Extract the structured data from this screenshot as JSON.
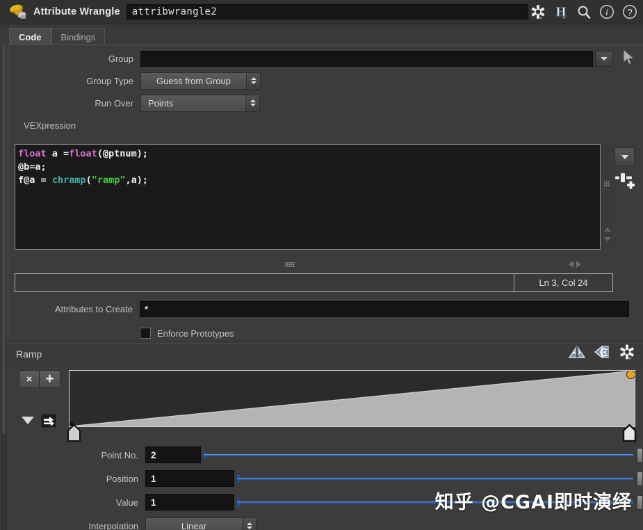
{
  "titlebar": {
    "node_type": "Attribute Wrangle",
    "node_name": "attribwrangle2",
    "icons": [
      {
        "name": "gear-icon",
        "label": "gear"
      },
      {
        "name": "houdini-h-icon",
        "label": "H"
      },
      {
        "name": "search-icon",
        "label": "search"
      },
      {
        "name": "info-icon",
        "label": "i"
      },
      {
        "name": "help-icon",
        "label": "?"
      }
    ]
  },
  "tabs": [
    {
      "label": "Code",
      "active": true
    },
    {
      "label": "Bindings",
      "active": false
    }
  ],
  "params": {
    "group": {
      "label": "Group",
      "value": "",
      "placeholder": ""
    },
    "group_type": {
      "label": "Group Type",
      "value": "Guess from Group"
    },
    "run_over": {
      "label": "Run Over",
      "value": "Points"
    },
    "vexpression": {
      "label": "VEXpression"
    },
    "attributes_to_create": {
      "label": "Attributes to Create",
      "value": "*"
    },
    "enforce_prototypes": {
      "label": "Enforce Prototypes",
      "checked": false
    }
  },
  "code": {
    "lines": [
      [
        {
          "t": "float",
          "c": "type"
        },
        {
          "t": " a =",
          "c": "txt"
        },
        {
          "t": "float",
          "c": "type"
        },
        {
          "t": "(@ptnum);",
          "c": "txt"
        }
      ],
      [
        {
          "t": "@b=a;",
          "c": "txt"
        }
      ],
      [
        {
          "t": "f@a = ",
          "c": "txt"
        },
        {
          "t": "chramp",
          "c": "fn"
        },
        {
          "t": "(",
          "c": "txt"
        },
        {
          "t": "\"ramp\"",
          "c": "str"
        },
        {
          "t": ",a);",
          "c": "txt"
        }
      ]
    ],
    "cursor_status": "Ln 3, Col 24"
  },
  "ramp": {
    "title": "Ramp",
    "header_icons": [
      {
        "name": "flip-ramp-icon"
      },
      {
        "name": "reverse-ramp-icon"
      },
      {
        "name": "ramp-gear-icon"
      }
    ],
    "delete_point_label": "×",
    "add_point_label": "+",
    "point_no": {
      "label": "Point No.",
      "value": "2"
    },
    "position": {
      "label": "Position",
      "value": "1"
    },
    "value": {
      "label": "Value",
      "value": "1"
    },
    "interpolation": {
      "label": "Interpolation",
      "value": "Linear"
    },
    "selected_point_color": "#e8a31a"
  },
  "watermark": "知乎 @CGAI即时演绎",
  "colors": {
    "panel_bg": "#3c3c3c",
    "titlebar_bg": "#313131",
    "field_bg": "#141414",
    "keyword": "#d16fd1",
    "function": "#3fb0a6",
    "string": "#3fcc3f",
    "slider_blue": "#2f62b8"
  }
}
